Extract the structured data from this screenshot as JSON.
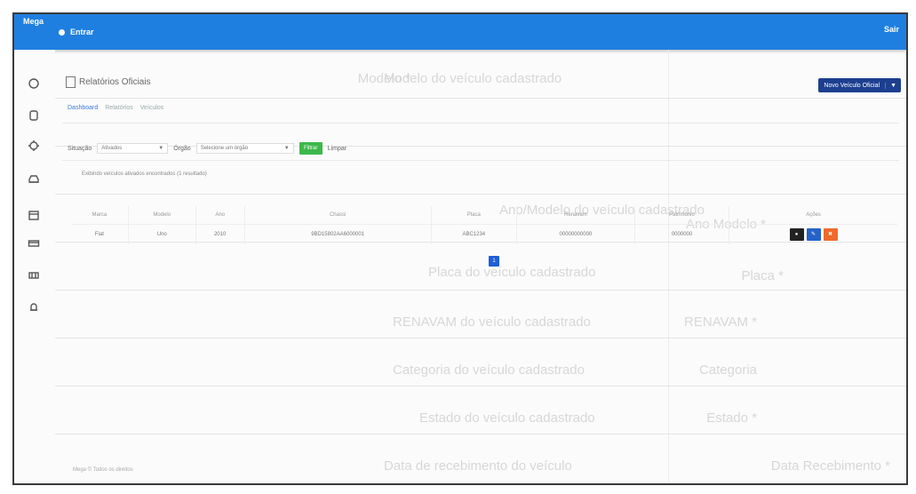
{
  "header": {
    "brand": "Mega",
    "menu_label": "Entrar",
    "user_label": "Sair",
    "accent": "#1f7fe0"
  },
  "sidebar": {
    "icons": [
      "home-icon",
      "box-icon",
      "settings-icon",
      "car-icon",
      "calendar-icon",
      "card-icon",
      "tag-icon",
      "bell-icon"
    ]
  },
  "page": {
    "title": "Relatórios Oficiais",
    "new_button": "Novo Veículo Oficial",
    "breadcrumb": [
      "Dashboard",
      "Relatórios",
      "Veículos"
    ],
    "filter": {
      "label1": "Situação",
      "value1": "Ativados",
      "label2": "Órgão",
      "value2": "Selecione um órgão",
      "submit": "Filtrar",
      "clear": "Limpar"
    },
    "note": "Exibindo veículos ativados encontrados (1 resultado)",
    "table": {
      "headers": [
        "Marca",
        "Modelo",
        "Ano",
        "Chassi",
        "Placa",
        "Renavam",
        "Patrimônio",
        "Ações"
      ],
      "rows": [
        {
          "marca": "Fiat",
          "modelo": "Uno",
          "ano": "2010",
          "chassi": "9BD15802AA6000001",
          "placa": "ABC1234",
          "renavam": "00000000000",
          "patrimonio": "0000000"
        }
      ],
      "actions": [
        "Visualizar",
        "Editar",
        "Excluir"
      ]
    },
    "pagination": "1",
    "footer": "Mega © Todos os direitos"
  },
  "background_form": {
    "rows": [
      {
        "label": "Modelo *",
        "value": "Modelo do veículo cadastrado"
      },
      {
        "label": "",
        "value": ""
      },
      {
        "label": "",
        "value": ""
      },
      {
        "label": "Ano Modelo *",
        "value": "Ano/Modelo do veículo cadastrado"
      },
      {
        "label": "Placa *",
        "value": "Placa do veículo cadastrado"
      },
      {
        "label": "RENAVAM *",
        "value": "RENAVAM do veículo cadastrado"
      },
      {
        "label": "Categoria",
        "value": "Categoria do veículo cadastrado"
      },
      {
        "label": "Estado *",
        "value": "Estado do veículo cadastrado"
      },
      {
        "label": "Data Recebimento *",
        "value": "Data de recebimento do veículo"
      }
    ]
  }
}
